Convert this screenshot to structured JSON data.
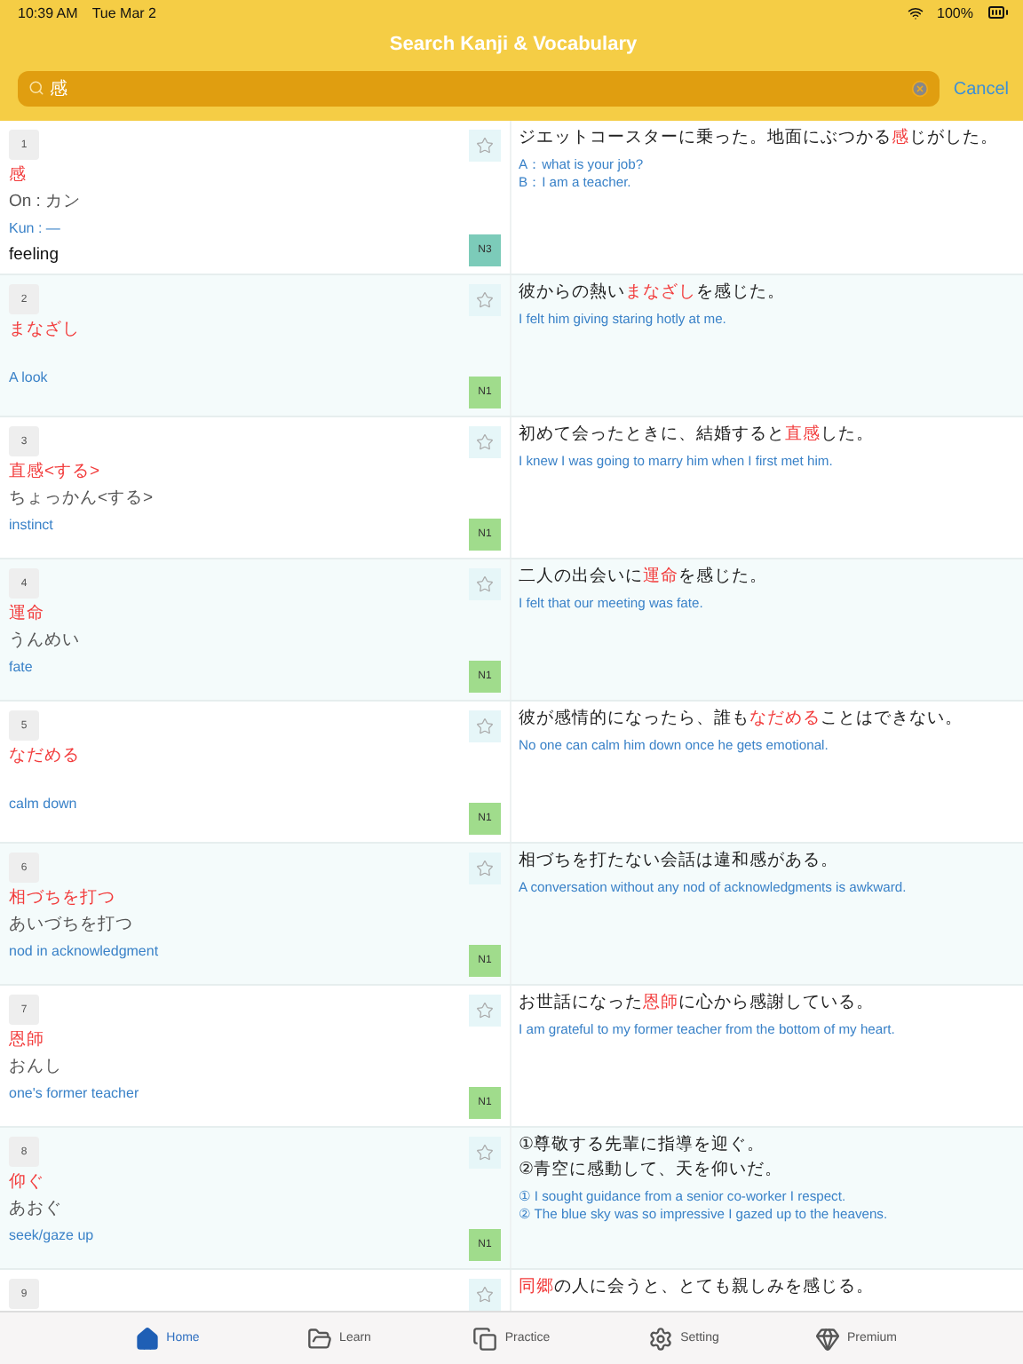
{
  "status_bar": {
    "time": "10:39 AM",
    "date": "Tue Mar 2",
    "battery": "100%"
  },
  "header": {
    "title": "Search Kanji & Vocabulary",
    "search": {
      "value": "感"
    },
    "cancel": "Cancel"
  },
  "entries": [
    {
      "number": "1",
      "starred": false,
      "kind": "kanji",
      "word": "感",
      "on": "On : カン",
      "kun": "Kun : —",
      "meaning": "feeling",
      "level": "N3",
      "color": "#7ccbb9",
      "sentences": [
        "ジエットコースターに乗った。地面にぶつかる**感**じがした。"
      ],
      "translations": [
        "A：what is your job?",
        "B：I am a teacher."
      ]
    },
    {
      "number": "2",
      "starred": false,
      "kind": "word",
      "word": "まなざし",
      "meaning": "A look",
      "level": "N1",
      "color": "#a0dc8c",
      "sentences": [
        "彼からの熱い**まなざし**を感じた。"
      ],
      "translations": [
        "I felt him giving staring hotly at me."
      ]
    },
    {
      "number": "3",
      "starred": false,
      "kind": "word",
      "word": "直感<する>",
      "reading": "ちょっかん<する>",
      "meaning": "instinct",
      "level": "N1",
      "color": "#a0dc8c",
      "sentences": [
        "初めて会ったときに、結婚すると**直感**した。"
      ],
      "translations": [
        "I knew I was going to marry him when I first met him."
      ]
    },
    {
      "number": "4",
      "starred": false,
      "kind": "word",
      "word": "運命",
      "reading": "うんめい",
      "meaning": "fate",
      "level": "N1",
      "color": "#a0dc8c",
      "sentences": [
        "二人の出会いに**運命**を感じた。"
      ],
      "translations": [
        "I felt that our meeting was fate."
      ]
    },
    {
      "number": "5",
      "starred": false,
      "kind": "word",
      "word": "なだめる",
      "meaning": "calm down",
      "level": "N1",
      "color": "#a0dc8c",
      "sentences": [
        "彼が感情的になったら、誰も**なだめる**ことはできない。"
      ],
      "translations": [
        "No one can calm him down once he gets emotional."
      ]
    },
    {
      "number": "6",
      "starred": false,
      "kind": "word",
      "word": "相づちを打つ",
      "reading": "あいづちを打つ",
      "meaning": "nod in acknowledgment",
      "level": "N1",
      "color": "#a0dc8c",
      "sentences": [
        "相づちを打たない会話は違和感がある。"
      ],
      "translations": [
        "A conversation without any nod of acknowledgments is awkward."
      ]
    },
    {
      "number": "7",
      "starred": false,
      "kind": "word",
      "word": "恩師",
      "reading": "おんし",
      "meaning": "one's former teacher",
      "level": "N1",
      "color": "#a0dc8c",
      "sentences": [
        "お世話になった**恩師**に心から感謝している。"
      ],
      "translations": [
        "I am grateful to my former teacher from the bottom of my heart."
      ]
    },
    {
      "number": "8",
      "starred": false,
      "kind": "word",
      "word": "仰ぐ",
      "reading": "あおぐ",
      "meaning": "seek/gaze up",
      "level": "N1",
      "color": "#a0dc8c",
      "sentences": [
        "①尊敬する先輩に指導を迎ぐ。",
        "②青空に感動して、天を仰いだ。"
      ],
      "translations": [
        "① I sought guidance from a senior co-worker I respect.",
        "② The blue sky was so impressive I gazed up to the heavens."
      ]
    },
    {
      "number": "9",
      "starred": false,
      "kind": "partial",
      "sentences": [
        "**同郷**の人に会うと、とても親しみを感じる。"
      ]
    }
  ],
  "tabs": [
    {
      "label": "Home",
      "kind": "home",
      "selected": true
    },
    {
      "label": "Learn",
      "kind": "learn",
      "selected": false
    },
    {
      "label": "Practice",
      "kind": "practice",
      "selected": false
    },
    {
      "label": "Setting",
      "kind": "setting",
      "selected": false
    },
    {
      "label": "Premium",
      "kind": "premium",
      "selected": false
    }
  ]
}
